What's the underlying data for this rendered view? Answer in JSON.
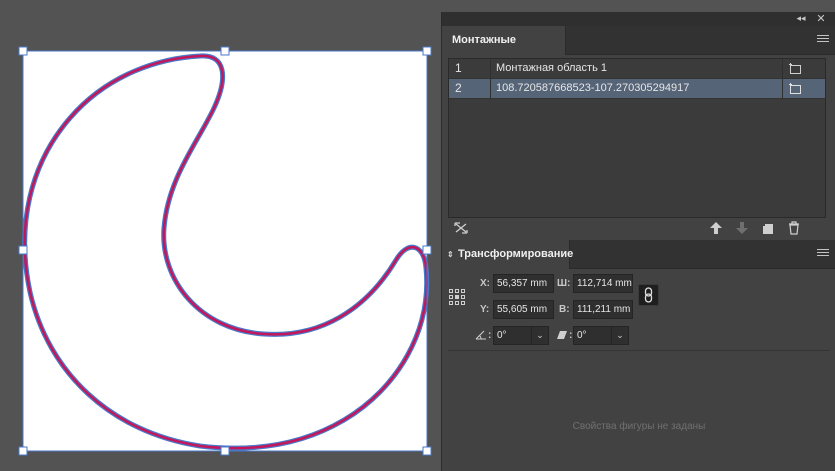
{
  "artboards_panel": {
    "tab_label": "Монтажные области",
    "rows": [
      {
        "num": "1",
        "name": "Монтажная область 1",
        "selected": false
      },
      {
        "num": "2",
        "name": "108.720587668523-107.270305294917",
        "selected": true
      }
    ],
    "footer_icons": [
      "rearrange-icon",
      "move-up-icon",
      "move-down-icon",
      "new-artboard-icon",
      "delete-icon"
    ]
  },
  "transform_panel": {
    "tab_label": "Трансформирование",
    "x_label": "X:",
    "x_value": "56,357 mm",
    "y_label": "Y:",
    "y_value": "55,605 mm",
    "w_label": "Ш:",
    "w_value": "112,714 mm",
    "h_label": "В:",
    "h_value": "111,211 mm",
    "angle_label": ":",
    "angle_value": "0°",
    "shear_label": ":",
    "shear_value": "0°",
    "no_properties_text": "Свойства фигуры не заданы"
  },
  "colors": {
    "canvas_bg": "#535353",
    "panel_bg": "#424242",
    "selection_row": "#566478",
    "path_stroke": "#c2185b",
    "selection_outline": "#4a78c8"
  }
}
